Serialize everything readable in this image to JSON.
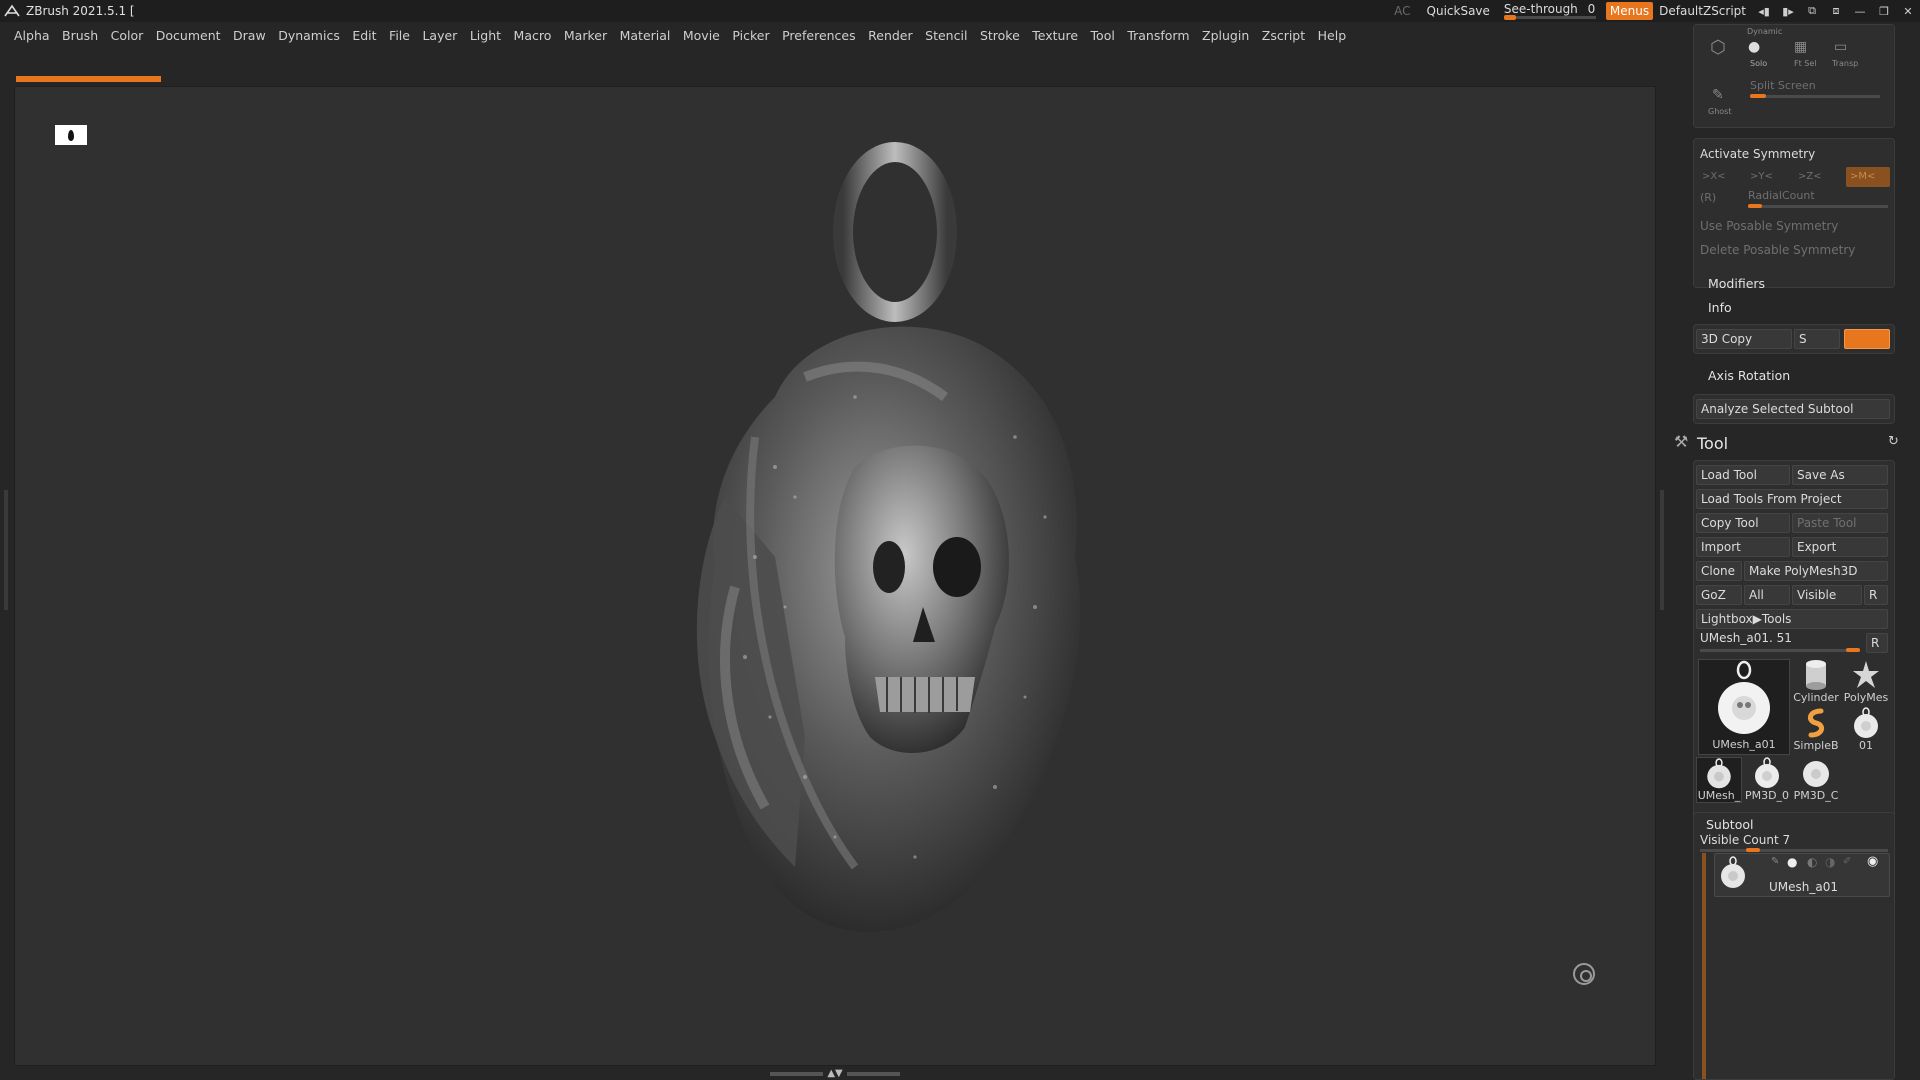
{
  "window": {
    "title": "ZBrush 2021.5.1 [",
    "ac_label": "AC",
    "quicksave_label": "QuickSave",
    "seethrough_label": "See-through",
    "seethrough_value": "0",
    "seethrough_level": 0,
    "menus_label": "Menus",
    "script_label": "DefaultZScript"
  },
  "menubar": {
    "items": [
      "Alpha",
      "Brush",
      "Color",
      "Document",
      "Draw",
      "Dynamics",
      "Edit",
      "File",
      "Layer",
      "Light",
      "Macro",
      "Marker",
      "Material",
      "Movie",
      "Picker",
      "Preferences",
      "Render",
      "Stencil",
      "Stroke",
      "Texture",
      "Tool",
      "Transform",
      "Zplugin",
      "Zscript",
      "Help"
    ]
  },
  "colors": {
    "accent": "#e8761e",
    "background": "#262626",
    "canvas": "#303030"
  },
  "topbox": {
    "dynamic_label": "Dynamic",
    "solo_label": "Solo",
    "ftsel_label": "Ft Sel",
    "transp_label": "Transp",
    "ghost_label": "Ghost",
    "split_screen_label": "Split Screen"
  },
  "symmetry": {
    "activate_label": "Activate Symmetry",
    "x_label": ">X<",
    "y_label": ">Y<",
    "z_label": ">Z<",
    "m_label": ">M<",
    "r_label": "(R)",
    "radial_label": "RadialCount",
    "use_posable_label": "Use Posable Symmetry",
    "delete_posable_label": "Delete Posable Symmetry"
  },
  "modifiers": {
    "modifiers_label": "Modifiers",
    "info_label": "Info",
    "copy3d_label": "3D Copy",
    "s_label": "S",
    "axis_rotation_label": "Axis Rotation",
    "analyze_label": "Analyze Selected Subtool"
  },
  "tool": {
    "title": "Tool",
    "buttons": {
      "load_tool": "Load Tool",
      "save_as": "Save As",
      "load_from_project": "Load Tools From Project",
      "copy_tool": "Copy Tool",
      "paste_tool": "Paste Tool",
      "import": "Import",
      "export": "Export",
      "clone": "Clone",
      "make_polymesh": "Make PolyMesh3D",
      "goz": "GoZ",
      "all": "All",
      "visible": "Visible",
      "r": "R",
      "lightbox_tools": "Lightbox▶Tools"
    },
    "current_tool": "UMesh_a01. 51",
    "current_r": "R",
    "thumbnails": [
      {
        "label": "UMesh_a01",
        "icon": "pendant-icon"
      },
      {
        "label": "Cylinder",
        "icon": "cylinder-icon"
      },
      {
        "label": "PolyMes",
        "icon": "star-icon"
      },
      {
        "label": "SimpleB",
        "icon": "simplebrush-icon"
      },
      {
        "label": "01",
        "icon": "pendant-icon"
      },
      {
        "label": "UMesh_",
        "icon": "pendant-icon"
      },
      {
        "label": "PM3D_0",
        "icon": "pendant-icon"
      },
      {
        "label": "PM3D_C",
        "icon": "pendant-icon"
      }
    ]
  },
  "subtool": {
    "header": "Subtool",
    "visible_count": "Visible Count 7",
    "item_label": "UMesh_a01"
  }
}
